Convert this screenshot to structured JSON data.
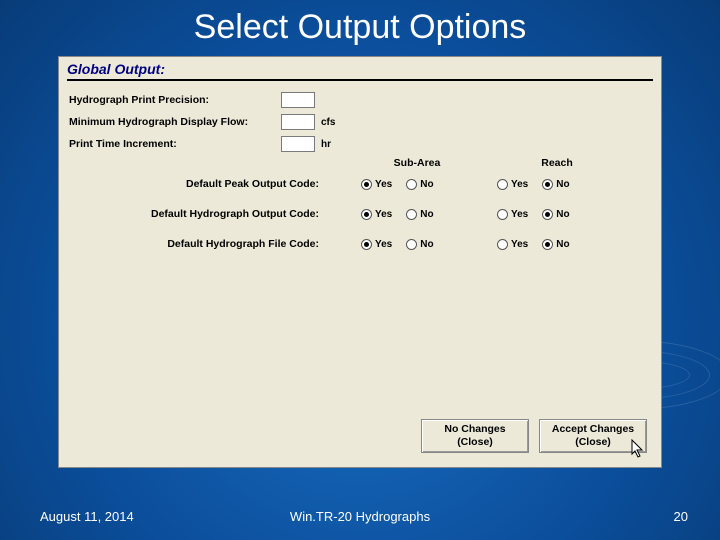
{
  "slide": {
    "title": "Select Output Options",
    "footer_date": "August 11, 2014",
    "footer_title": "Win.TR-20 Hydrographs",
    "page_number": "20"
  },
  "dialog": {
    "section_title": "Global Output:",
    "fields": {
      "precision": {
        "label": "Hydrograph Print Precision:",
        "value": "",
        "unit": ""
      },
      "min_flow": {
        "label": "Minimum Hydrograph Display Flow:",
        "value": "",
        "unit": "cfs"
      },
      "time_inc": {
        "label": "Print Time Increment:",
        "value": "",
        "unit": "hr"
      }
    },
    "columns": {
      "sub": "Sub-Area",
      "reach": "Reach"
    },
    "yes": "Yes",
    "no": "No",
    "codes": [
      {
        "label": "Default Peak Output Code:",
        "sub": "yes",
        "reach": "no"
      },
      {
        "label": "Default Hydrograph Output Code:",
        "sub": "yes",
        "reach": "no"
      },
      {
        "label": "Default Hydrograph File Code:",
        "sub": "yes",
        "reach": "no"
      }
    ],
    "buttons": {
      "no_changes": "No Changes\n(Close)",
      "accept": "Accept Changes\n(Close)"
    }
  }
}
